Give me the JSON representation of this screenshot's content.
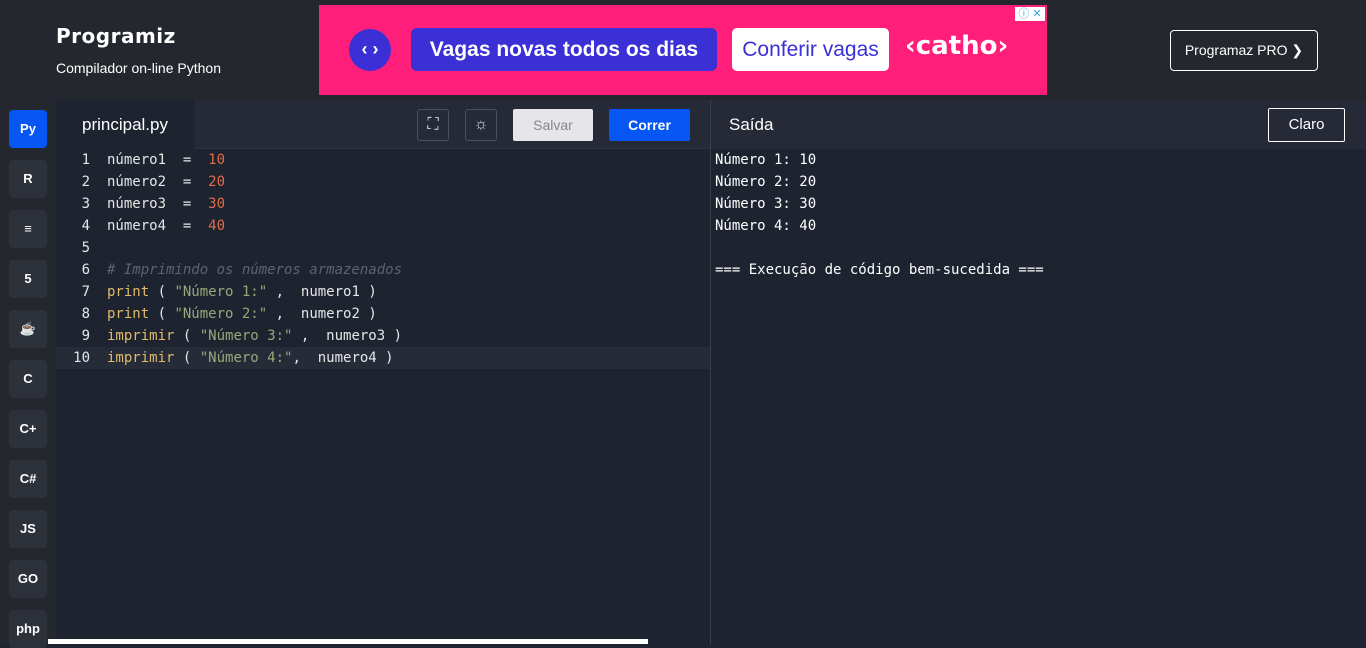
{
  "header": {
    "logo": "Programiz",
    "subtitle": "Compilador on-line Python",
    "pro_button": "Programaz PRO ❯"
  },
  "ad": {
    "arrows": "‹ ›",
    "headline": "Vagas novas todos os dias",
    "cta": "Conferir vagas",
    "brand": "‹catho›",
    "close": "ⓘ ✕"
  },
  "sidebar": {
    "items": [
      {
        "name": "python-icon",
        "label": "Py",
        "active": true
      },
      {
        "name": "r-icon",
        "label": "R"
      },
      {
        "name": "sql-icon",
        "label": "≡"
      },
      {
        "name": "html5-icon",
        "label": "5"
      },
      {
        "name": "java-icon",
        "label": "☕"
      },
      {
        "name": "c-icon",
        "label": "C"
      },
      {
        "name": "cpp-icon",
        "label": "C+"
      },
      {
        "name": "csharp-icon",
        "label": "C#"
      },
      {
        "name": "javascript-icon",
        "label": "JS"
      },
      {
        "name": "go-icon",
        "label": "GO"
      },
      {
        "name": "php-icon",
        "label": "php"
      }
    ]
  },
  "editor": {
    "file_tab": "principal.py",
    "save_label": "Salvar",
    "run_label": "Correr",
    "lines": [
      {
        "n": "1",
        "tokens": [
          {
            "t": "número1  =  ",
            "c": ""
          },
          {
            "t": "10",
            "c": "num"
          }
        ]
      },
      {
        "n": "2",
        "tokens": [
          {
            "t": "número2  =  ",
            "c": ""
          },
          {
            "t": "20",
            "c": "num"
          }
        ]
      },
      {
        "n": "3",
        "tokens": [
          {
            "t": "número3  =  ",
            "c": ""
          },
          {
            "t": "30",
            "c": "num"
          }
        ]
      },
      {
        "n": "4",
        "tokens": [
          {
            "t": "número4  =  ",
            "c": ""
          },
          {
            "t": "40",
            "c": "num"
          }
        ]
      },
      {
        "n": "5",
        "tokens": []
      },
      {
        "n": "6",
        "tokens": [
          {
            "t": "# Imprimindo os números armazenados",
            "c": "cmt"
          }
        ]
      },
      {
        "n": "7",
        "tokens": [
          {
            "t": "print",
            "c": "kw"
          },
          {
            "t": " ( ",
            "c": ""
          },
          {
            "t": "\"Número 1:\"",
            "c": "str"
          },
          {
            "t": " ,  numero1 )",
            "c": ""
          }
        ]
      },
      {
        "n": "8",
        "tokens": [
          {
            "t": "print",
            "c": "kw"
          },
          {
            "t": " ( ",
            "c": ""
          },
          {
            "t": "\"Número 2:\"",
            "c": "str"
          },
          {
            "t": " ,  numero2 )",
            "c": ""
          }
        ]
      },
      {
        "n": "9",
        "tokens": [
          {
            "t": "imprimir",
            "c": "kw"
          },
          {
            "t": " ( ",
            "c": ""
          },
          {
            "t": "\"Número 3:\"",
            "c": "str"
          },
          {
            "t": " ,  numero3 )",
            "c": ""
          }
        ]
      },
      {
        "n": "10",
        "tokens": [
          {
            "t": "imprimir",
            "c": "kw"
          },
          {
            "t": " ( ",
            "c": ""
          },
          {
            "t": "\"Número 4:\"",
            "c": "str"
          },
          {
            "t": ",  numero4 )",
            "c": ""
          }
        ],
        "current": true
      }
    ]
  },
  "output": {
    "title": "Saída",
    "clear_label": "Claro",
    "lines": [
      "Número 1: 10",
      "Número 2: 20",
      "Número 3: 30",
      "Número 4: 40",
      "",
      "=== Execução de código bem-sucedida ==="
    ]
  }
}
